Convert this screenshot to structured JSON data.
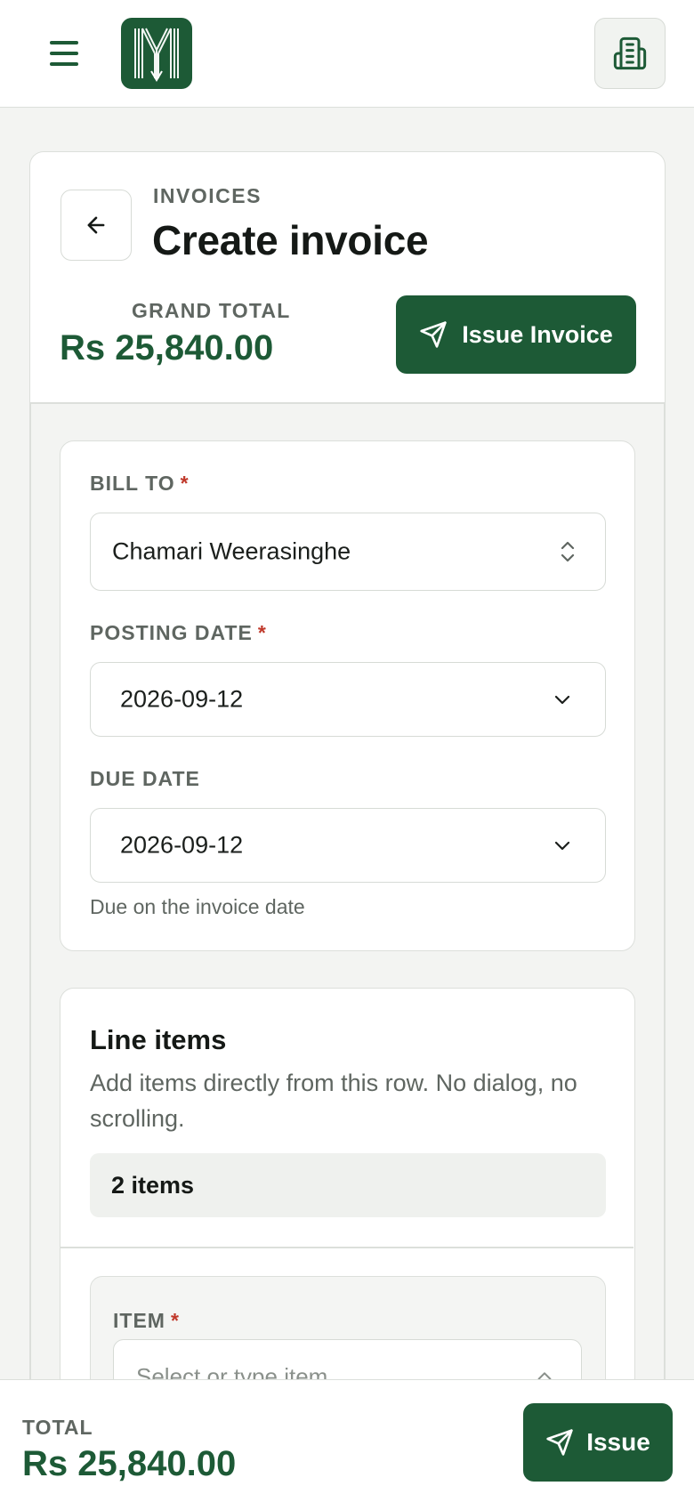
{
  "app": {
    "logo_icon": "brand-logo-mark",
    "menu_icon": "menu-icon",
    "org_icon": "building-icon",
    "accent_color": "#1d5a36"
  },
  "header": {
    "breadcrumb": "INVOICES",
    "title": "Create invoice",
    "back_icon": "arrow-left-icon",
    "grand_total_label": "GRAND TOTAL",
    "grand_total_value": "Rs 25,840.00",
    "issue_invoice_label": "Issue Invoice",
    "issue_icon": "send-icon"
  },
  "form": {
    "bill_to": {
      "label": "BILL TO",
      "required_mark": "*",
      "value": "Chamari Weerasinghe"
    },
    "posting_date": {
      "label": "POSTING DATE",
      "required_mark": "*",
      "value": "2026-09-12"
    },
    "due_date": {
      "label": "DUE DATE",
      "value": "2026-09-12",
      "helper": "Due on the invoice date"
    }
  },
  "line_items": {
    "title": "Line items",
    "subtitle": "Add items directly from this row. No dialog, no scrolling.",
    "count_label": "2 items",
    "row": {
      "item_label": "ITEM",
      "required_mark": "*",
      "placeholder": "Select or type item"
    }
  },
  "footer": {
    "total_label": "TOTAL",
    "total_value": "Rs 25,840.00",
    "issue_label": "Issue"
  }
}
